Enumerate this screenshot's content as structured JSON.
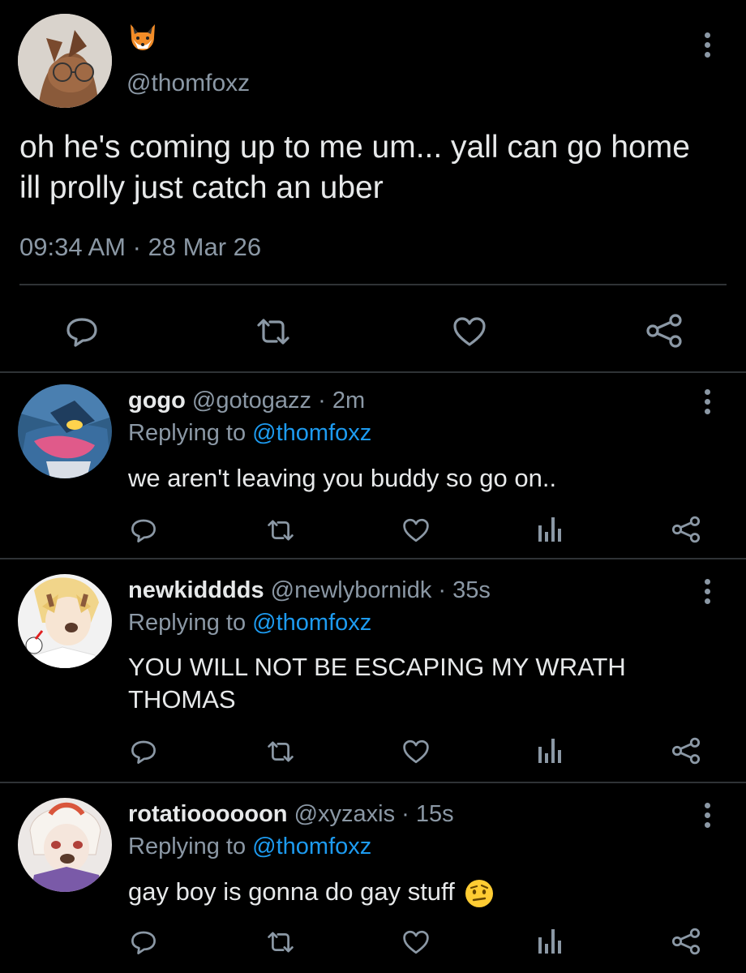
{
  "main_tweet": {
    "emoji_name": "fox-emoji",
    "handle": "@thomfoxz",
    "text": "oh he's coming up to me um... yall can go home ill prolly just catch an uber",
    "time": "09:34 AM",
    "separator": "·",
    "date": "28 Mar 26"
  },
  "replies": [
    {
      "name": "gogo",
      "handle": "@gotogazz",
      "sep": "·",
      "time": "2m",
      "replying_prefix": "Replying to",
      "replying_to": "@thomfoxz",
      "text": "we aren't leaving you buddy so go on.."
    },
    {
      "name": "newkidddds",
      "handle": "@newlybornidk",
      "sep": "·",
      "time": "35s",
      "replying_prefix": "Replying to",
      "replying_to": "@thomfoxz",
      "text": "YOU WILL NOT BE ESCAPING MY WRATH THOMAS"
    },
    {
      "name": "rotatioooooon",
      "handle": "@xyzaxis",
      "sep": "·",
      "time": "15s",
      "replying_prefix": "Replying to",
      "replying_to": "@thomfoxz",
      "text": "gay boy is gonna do gay stuff",
      "emoji_name": "raised-eyebrow-emoji"
    }
  ],
  "colors": {
    "background": "#000000",
    "text": "#e7e9ea",
    "secondary": "#8b98a5",
    "accent": "#1d9bf0",
    "divider": "#2f3336"
  },
  "icons": [
    "reply-icon",
    "retweet-icon",
    "like-icon",
    "share-icon",
    "analytics-icon",
    "more-icon"
  ]
}
